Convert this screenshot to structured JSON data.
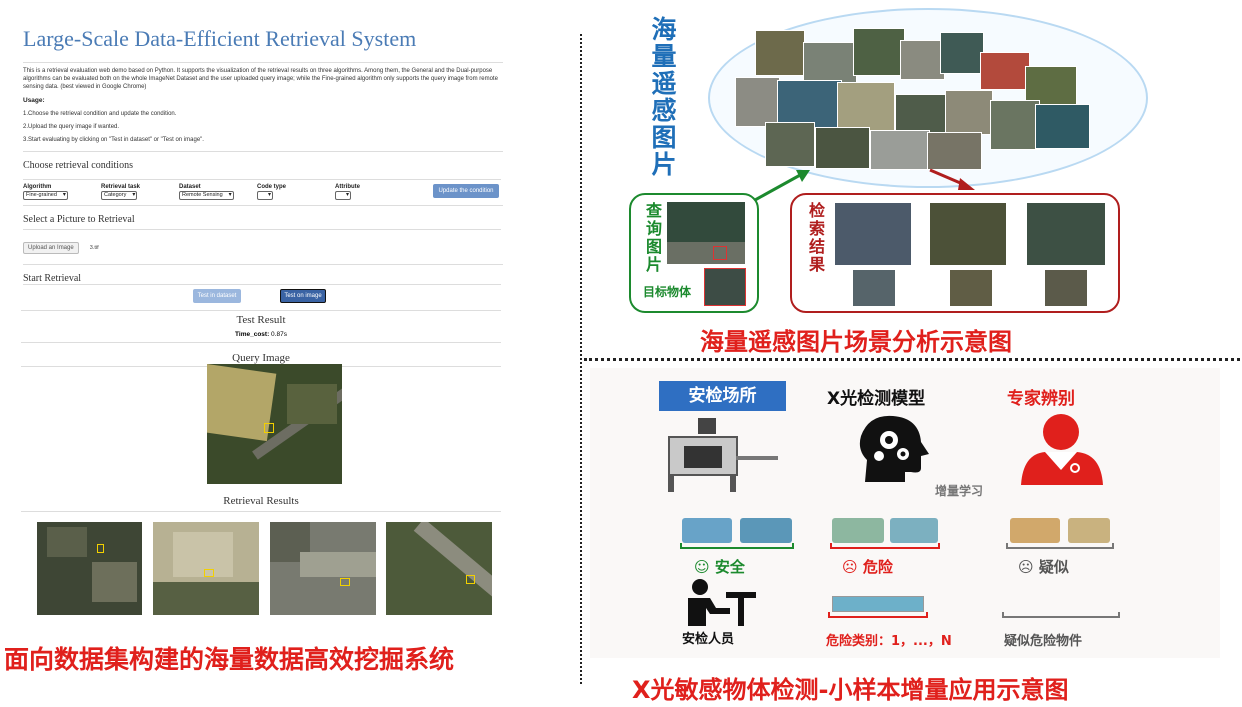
{
  "left_demo": {
    "title": "Large-Scale Data-Efficient Retrieval System",
    "description": "This is a retrieval evaluation web demo based on Python. It supports the visualization of the retrieval results on three algorithms. Among them, the General and the Dual-purpose algorithms can be evaluated both on the whole ImageNet Dataset and the user uploaded query image; while the Fine-grained algorithm only supports the query image from remote sensing data. (best viewed in Google Chrome)",
    "usage_title": "Usage:",
    "usage_steps": [
      "1.Choose the retrieval condition and update the condition.",
      "2.Upload the query image if wanted.",
      "3.Start evaluating by clicking on \"Test in dataset\" or \"Test on image\"."
    ],
    "choose_title": "Choose retrieval conditions",
    "conditions": {
      "algorithm": {
        "label": "Algorithm",
        "value": "Fine-grained"
      },
      "task": {
        "label": "Retrieval task",
        "value": "Category"
      },
      "dataset": {
        "label": "Dataset",
        "value": "Remote Sensing"
      },
      "code_type": {
        "label": "Code type",
        "value": ""
      },
      "attribute": {
        "label": "Attribute",
        "value": ""
      }
    },
    "update_button": "Update the condition",
    "select_title": "Select a Picture to Retrieval",
    "upload_button": "Upload an Image",
    "file_name": "3.tif",
    "start_title": "Start Retrieval",
    "test_dataset_button": "Test in dataset",
    "test_image_button": "Test on image",
    "test_result_title": "Test Result",
    "time_cost_label": "Time_cost:",
    "time_cost_value": "0.87s",
    "query_title": "Query Image",
    "results_title": "Retrieval Results"
  },
  "left_caption": "面向数据集构建的海量数据高效挖掘系统",
  "top_right": {
    "cloud_label": "海量遥感图片",
    "query_label": "查询图片",
    "target_label": "目标物体",
    "results_label": "检索结果",
    "caption": "海量遥感图片场景分析示意图"
  },
  "bottom_right": {
    "security_site": "安检场所",
    "xray_model": "X光检测模型",
    "expert": "专家辨别",
    "incremental": "增量学习",
    "safe": "安全",
    "danger": "危险",
    "suspect": "疑似",
    "inspector": "安检人员",
    "danger_classes": "危险类别：1，...，N",
    "suspect_items": "疑似危险物件",
    "caption": "X光敏感物体检测-小样本增量应用示意图"
  },
  "colors": {
    "title_blue": "#4a7bb5",
    "button_blue": "#6c93c9",
    "caption_red": "#e0201c",
    "cloud_text_blue": "#1f6fb8",
    "query_green": "#1c8a2e",
    "result_red": "#b01e1e"
  }
}
